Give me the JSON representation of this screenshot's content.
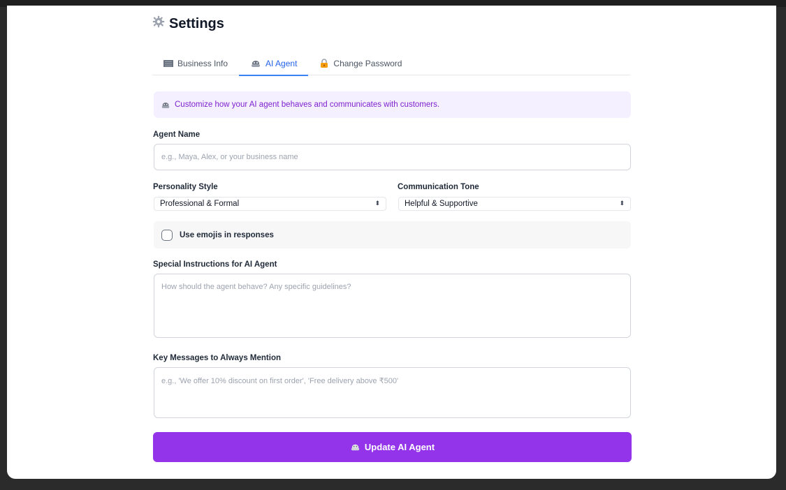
{
  "page": {
    "title": "Settings"
  },
  "tabs": [
    {
      "label": "Business Info",
      "icon": "building-icon",
      "active": false
    },
    {
      "label": "AI Agent",
      "icon": "robot-icon",
      "active": true
    },
    {
      "label": "Change Password",
      "icon": "lock-icon",
      "active": false
    }
  ],
  "banner": {
    "text": "Customize how your AI agent behaves and communicates with customers."
  },
  "agent_name": {
    "label": "Agent Name",
    "placeholder": "e.g., Maya, Alex, or your business name",
    "value": ""
  },
  "personality": {
    "label": "Personality Style",
    "value": "Professional & Formal"
  },
  "tone": {
    "label": "Communication Tone",
    "value": "Helpful & Supportive"
  },
  "emojis": {
    "label": "Use emojis in responses",
    "checked": false
  },
  "instructions": {
    "label": "Special Instructions for AI Agent",
    "placeholder": "How should the agent behave? Any specific guidelines?",
    "value": ""
  },
  "key_messages": {
    "label": "Key Messages to Always Mention",
    "placeholder": "e.g., 'We offer 10% discount on first order', 'Free delivery above ₹500'",
    "value": ""
  },
  "submit": {
    "label": "Update AI Agent"
  },
  "colors": {
    "accent": "#9333ea",
    "tab_active": "#2563eb",
    "banner_bg": "#f5f0ff",
    "banner_text": "#7e22ce"
  }
}
